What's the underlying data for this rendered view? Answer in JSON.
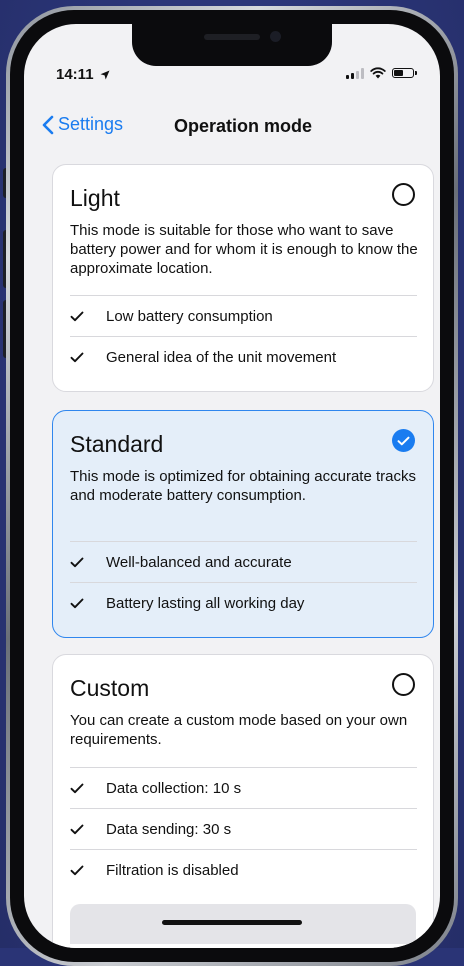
{
  "status_bar": {
    "time": "14:11"
  },
  "nav": {
    "back_label": "Settings",
    "title": "Operation mode"
  },
  "modes": [
    {
      "title": "Light",
      "description": "This mode is suitable for those who want to save battery power and for whom it is enough to know the approximate location.",
      "selected": false,
      "features": [
        "Low battery consumption",
        "General idea of the unit movement"
      ]
    },
    {
      "title": "Standard",
      "description": "This mode is optimized for obtaining accurate tracks and moderate battery consumption.",
      "selected": true,
      "features": [
        "Well-balanced and accurate",
        "Battery lasting all working day"
      ]
    },
    {
      "title": "Custom",
      "description": "You can create a custom mode based on your own requirements.",
      "selected": false,
      "features": [
        "Data collection: 10 s",
        "Data sending: 30 s",
        "Filtration is disabled"
      ]
    }
  ],
  "colors": {
    "accent": "#1a7cf0",
    "selected_card_bg": "#e4eef9",
    "background": "#f2f2f4",
    "backdrop": "#2a3476"
  },
  "icons": {
    "back": "chevron-left-icon",
    "check": "checkmark-icon",
    "radio_selected": "radio-checked-icon",
    "radio_empty": "radio-empty-icon",
    "location": "location-arrow-icon",
    "signal": "cellular-signal-icon",
    "wifi": "wifi-icon",
    "battery": "battery-icon"
  }
}
